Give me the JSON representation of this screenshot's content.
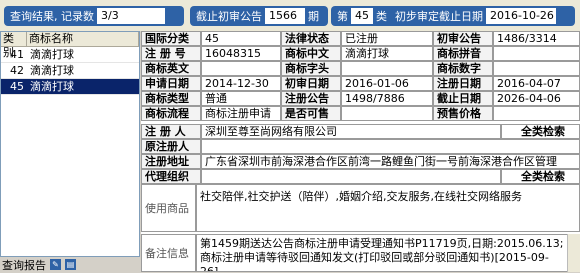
{
  "topbar": {
    "result_label": "查询结果, 记录数",
    "result_count": "3/3",
    "deadline_label": "截止初审公告",
    "deadline_value": "1566",
    "deadline_unit": "期",
    "class_prefix": "第",
    "class_value": "45",
    "class_suffix": "类",
    "prelim_label": "初步审定截止日期",
    "prelim_value": "2016-10-26",
    "prelim_suffix": "类"
  },
  "list": {
    "col_class": "类别",
    "col_name": "商标名称",
    "rows": [
      {
        "cls": "41",
        "name": "滴滴打球"
      },
      {
        "cls": "42",
        "name": "滴滴打球"
      },
      {
        "cls": "45",
        "name": "滴滴打球"
      }
    ]
  },
  "status": {
    "label": "查询报告"
  },
  "detail": {
    "intl_class_label": "国际分类",
    "intl_class": "45",
    "legal_status_label": "法律状态",
    "legal_status": "已注册",
    "prelim_notice_label": "初审公告",
    "prelim_notice": "1486/3314",
    "reg_no_label": "注 册 号",
    "reg_no": "16048315",
    "name_cn_label": "商标中文",
    "name_cn": "滴滴打球",
    "pinyin_label": "商标拼音",
    "pinyin": "",
    "english_label": "商标英文",
    "english": "",
    "head_label": "商标字头",
    "head": "",
    "digits_label": "商标数字",
    "digits": "",
    "apply_date_label": "申请日期",
    "apply_date": "2014-12-30",
    "prelim_date_label": "初审日期",
    "prelim_date": "2016-01-06",
    "reg_date_label": "注册日期",
    "reg_date": "2016-04-07",
    "type_label": "商标类型",
    "type": "普通",
    "reg_notice_label": "注册公告",
    "reg_notice": "1498/7886",
    "expire_label": "截止日期",
    "expire": "2026-04-06",
    "flow_label": "商标流程",
    "flow": "商标注册申请",
    "shared_label": "是否可售",
    "shared": "",
    "price_label": "预售价格",
    "price": "",
    "registrant_label": "注 册 人",
    "registrant": "深圳至尊至尚网络有限公司",
    "search_all": "全类检索",
    "orig_reg_label": "原注册人",
    "orig_reg": "",
    "address_label": "注册地址",
    "address": "广东省深圳市前海深港合作区前湾一路鲤鱼门街一号前海深港合作区管理",
    "agent_label": "代理组织",
    "agent": "",
    "goods_label": "使用商品",
    "goods": "社交陪伴,社交护送（陪伴）,婚姻介绍,交友服务,在线社交网络服务",
    "notes_label": "备注信息",
    "notes": "第1459期送达公告商标注册申请受理通知书P11719页,日期:2015.06.13;商标注册申请等待驳回通知发文(打印驳回或部分驳回通知书)[2015-09-26]"
  }
}
